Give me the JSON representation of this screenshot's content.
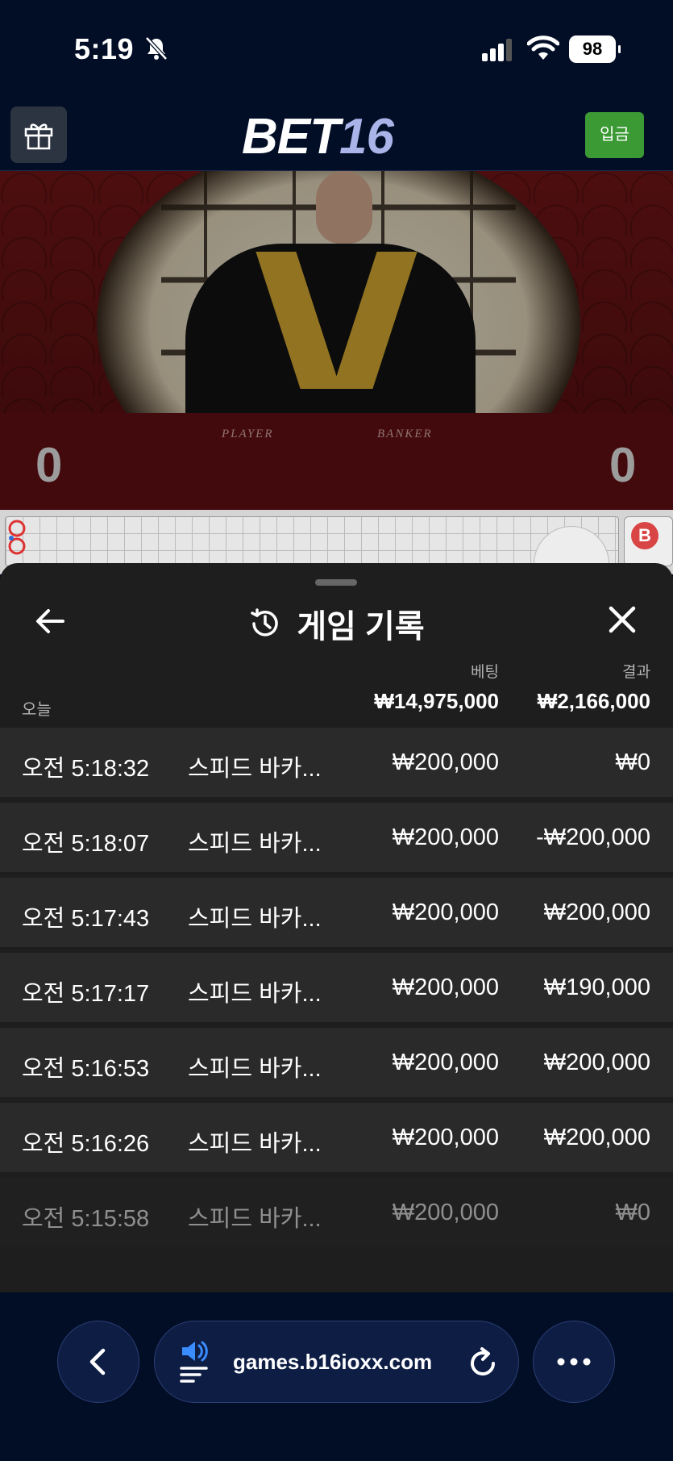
{
  "status_bar": {
    "time": "5:19",
    "battery": "98"
  },
  "header": {
    "logo_bet": "BET",
    "logo_num": "16",
    "deposit_label": "입금"
  },
  "video": {
    "player_label": "PLAYER",
    "banker_label": "BANKER",
    "player_score": "0",
    "banker_score": "0"
  },
  "roadmap": {
    "side_label": "B"
  },
  "history": {
    "title": "게임 기록",
    "columns": {
      "bet": "베팅",
      "result": "결과"
    },
    "today_label": "오늘",
    "total_bet": "₩14,975,000",
    "total_result": "₩2,166,000",
    "rows": [
      {
        "time": "오전 5:18:32",
        "game": "스피드 바카...",
        "bet": "₩200,000",
        "result": "₩0"
      },
      {
        "time": "오전 5:18:07",
        "game": "스피드 바카...",
        "bet": "₩200,000",
        "result": "-₩200,000"
      },
      {
        "time": "오전 5:17:43",
        "game": "스피드 바카...",
        "bet": "₩200,000",
        "result": "₩200,000"
      },
      {
        "time": "오전 5:17:17",
        "game": "스피드 바카...",
        "bet": "₩200,000",
        "result": "₩190,000"
      },
      {
        "time": "오전 5:16:53",
        "game": "스피드 바카...",
        "bet": "₩200,000",
        "result": "₩200,000"
      },
      {
        "time": "오전 5:16:26",
        "game": "스피드 바카...",
        "bet": "₩200,000",
        "result": "₩200,000"
      },
      {
        "time": "오전 5:15:58",
        "game": "스피드 바카...",
        "bet": "₩200,000",
        "result": "₩0"
      }
    ]
  },
  "browser": {
    "url": "games.b16ioxx.com"
  },
  "icons": {
    "gift": "gift-icon",
    "back": "arrow-left-icon",
    "history": "history-icon",
    "close": "close-icon",
    "nav_back": "chevron-left-icon",
    "speaker": "speaker-icon",
    "reload": "reload-icon",
    "more": "more-icon"
  },
  "colors": {
    "deposit": "#3c9a35",
    "sheet": "#1e1e1e",
    "row": "#2a2a2a",
    "browser": "#020d26",
    "pill": "#0d1d44"
  }
}
